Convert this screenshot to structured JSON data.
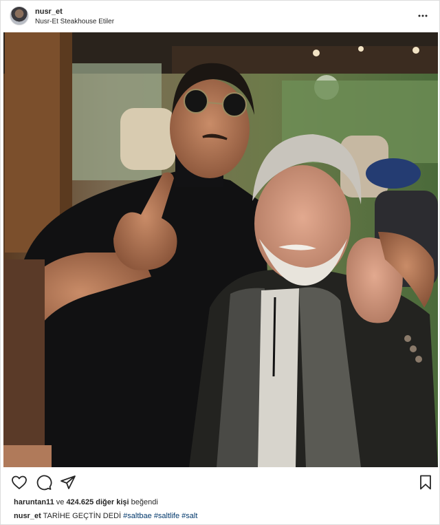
{
  "header": {
    "username": "nusr_et",
    "location": "Nusr-Et Steakhouse Etiler"
  },
  "likes": {
    "first_user": "haruntan11",
    "connector": "ve",
    "count": "424.625",
    "others": "diğer kişi",
    "suffix": "beğendi"
  },
  "caption": {
    "username": "nusr_et",
    "text": "TARİHE GEÇTİN DEDİ",
    "hashtags": [
      "#saltbae",
      "#saltlife",
      "#salt"
    ]
  },
  "icons": {
    "more": "more-options-icon",
    "like": "heart-icon",
    "comment": "comment-icon",
    "share": "share-icon",
    "save": "bookmark-icon"
  },
  "colors": {
    "text": "#262626",
    "hashtag": "#00376b",
    "border": "#dbdbdb"
  }
}
